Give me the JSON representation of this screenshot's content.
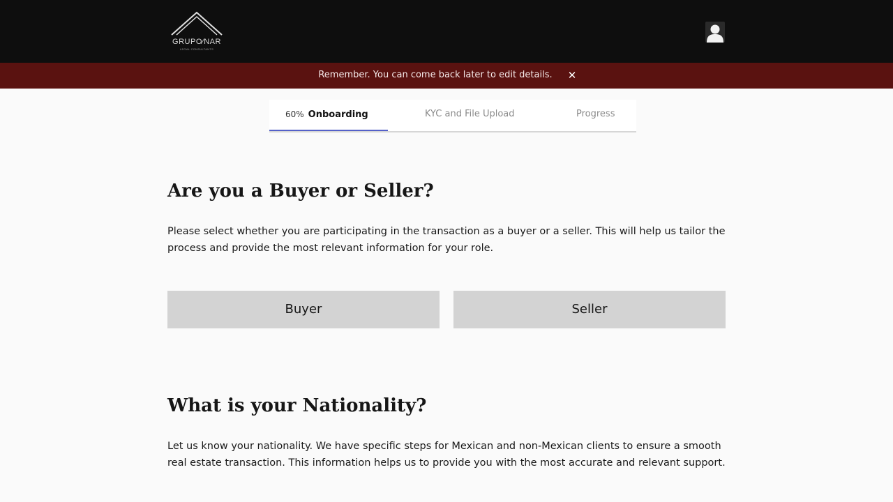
{
  "header": {
    "logo_text": "GRUPO⁄NAR",
    "logo_subtext": "LEGAL CONSULTANTS",
    "avatar_icon": "user-silhouette-icon"
  },
  "banner": {
    "message": "Remember. You can come back later to edit details.",
    "close_glyph": "✕",
    "background": "#5a1210"
  },
  "tabs": {
    "progress": "60%",
    "items": [
      {
        "label": "Onboarding",
        "active": true
      },
      {
        "label": "KYC and File Upload",
        "active": false
      },
      {
        "label": "Progress",
        "active": false
      }
    ],
    "accent": "#5561c9"
  },
  "sections": {
    "role": {
      "title": "Are you a Buyer or Seller?",
      "description": "Please select whether you are participating in the transaction as a buyer or a seller. This will help us tailor the process and provide the most relevant information for your role.",
      "buyer_label": "Buyer",
      "seller_label": "Seller"
    },
    "nationality": {
      "title": "What is your Nationality?",
      "description": "Let us know your nationality. We have specific steps for Mexican and non-Mexican clients to ensure a smooth real estate transaction. This information helps us to provide you with the most accurate and relevant support."
    }
  }
}
